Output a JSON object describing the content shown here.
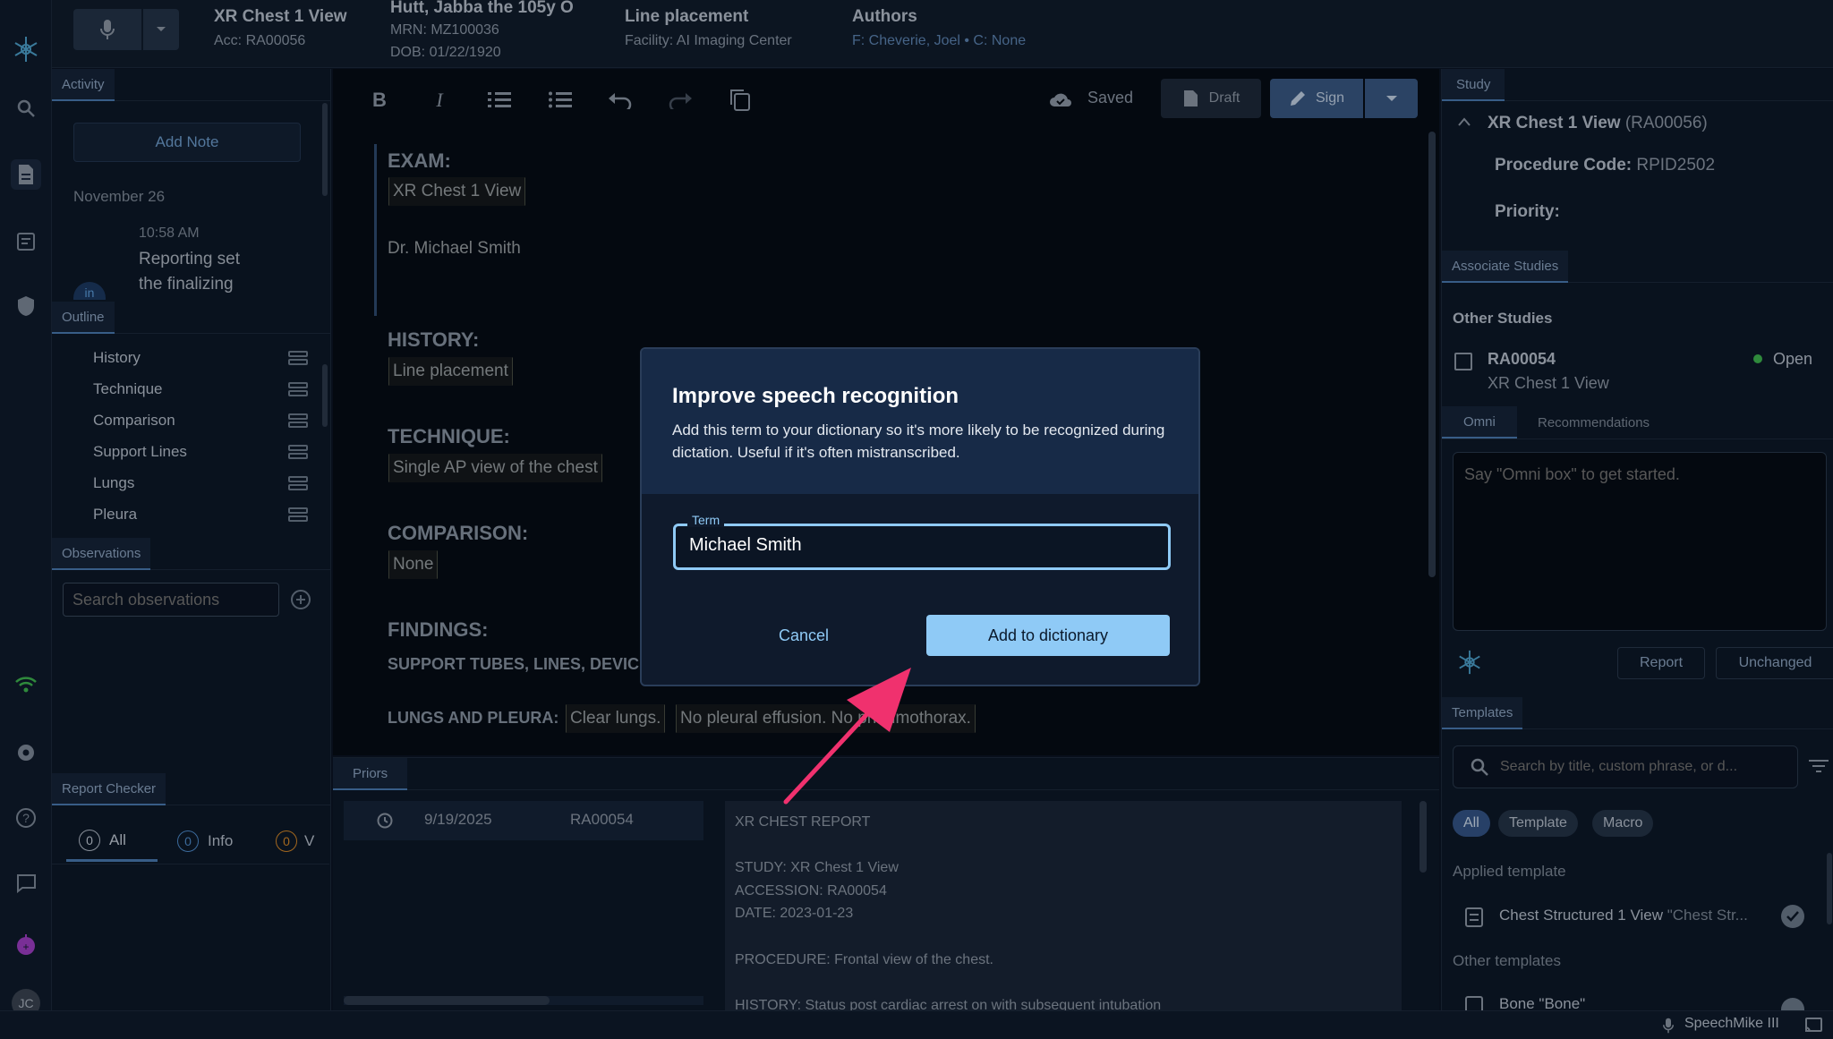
{
  "header": {
    "study_title": "XR Chest 1 View",
    "accession": "Acc: RA00056",
    "patient_name": "Hutt, Jabba the 105y O",
    "mrn": "MRN: MZ100036",
    "dob": "DOB: 01/22/1920",
    "reason_title": "Line placement",
    "facility": "Facility: AI Imaging Center",
    "authors_title": "Authors",
    "authors": "F: Cheverie, Joel • C: None"
  },
  "activity": {
    "tab": "Activity",
    "add_note": "Add Note",
    "date": "November 26",
    "time": "10:58 AM",
    "message_line1": "Reporting set",
    "message_line2": "the finalizing"
  },
  "outline": {
    "tab": "Outline",
    "items": [
      "History",
      "Technique",
      "Comparison",
      "Support Lines",
      "Lungs",
      "Pleura"
    ]
  },
  "observations": {
    "tab": "Observations",
    "search_placeholder": "Search observations"
  },
  "report_checker": {
    "tab": "Report Checker",
    "all_count": "0",
    "all_label": "All",
    "info_count": "0",
    "info_label": "Info",
    "warn_count": "0",
    "warn_label": "V"
  },
  "editor": {
    "saved": "Saved",
    "draft": "Draft",
    "sign": "Sign",
    "exam_title": "EXAM:",
    "exam_value": "XR Chest 1 View",
    "doctor": "Dr. Michael Smith",
    "history_title": "HISTORY:",
    "history_value": "Line placement",
    "technique_title": "TECHNIQUE:",
    "technique_value": "Single AP view of the chest",
    "comparison_title": "COMPARISON:",
    "comparison_value": "None",
    "findings_title": "FINDINGS:",
    "support_line": "SUPPORT TUBES, LINES, DEVIC",
    "lungs_label": "LUNGS AND PLEURA:",
    "lungs_value1": "Clear lungs.",
    "lungs_value2": "No pleural effusion. No pneumothorax."
  },
  "priors": {
    "tab": "Priors",
    "row_date": "9/19/2025",
    "row_acc": "RA00054",
    "report_lines": [
      "XR CHEST REPORT",
      "",
      "STUDY: XR Chest 1 View",
      "ACCESSION: RA00054",
      "DATE: 2023-01-23",
      "",
      "PROCEDURE: Frontal view of the chest.",
      "",
      "HISTORY: Status post cardiac arrest on with subsequent intubation"
    ]
  },
  "study": {
    "tab": "Study",
    "title": "XR Chest 1 View",
    "title_acc": "(RA00056)",
    "procedure_label": "Procedure Code:",
    "procedure_value": "RPID2502",
    "priority_label": "Priority:",
    "assoc_tab": "Associate Studies",
    "other_studies": "Other Studies",
    "other_acc": "RA00054",
    "other_title": "XR Chest 1 View",
    "other_status": "Open"
  },
  "omni": {
    "tab_omni": "Omni",
    "tab_recs": "Recommendations",
    "placeholder": "Say \"Omni box\" to get started.",
    "report_btn": "Report",
    "unchanged_btn": "Unchanged"
  },
  "templates": {
    "tab": "Templates",
    "search_placeholder": "Search by title, custom phrase, or d...",
    "chips": [
      "All",
      "Template",
      "Macro"
    ],
    "applied_label": "Applied template",
    "applied_name": "Chest Structured 1 View",
    "applied_alias": "\"Chest Str...",
    "other_label": "Other templates",
    "other_first": "Bone \"Bone\""
  },
  "status": {
    "device": "SpeechMike III",
    "avatar": "JC"
  },
  "modal": {
    "title": "Improve speech recognition",
    "description": "Add this term to your dictionary so it's more likely to be recognized during dictation. Useful if it's often mistranscribed.",
    "term_label": "Term",
    "term_value": "Michael Smith",
    "cancel": "Cancel",
    "add": "Add to dictionary"
  },
  "colors": {
    "accent": "#8fcaf6",
    "arrow": "#f0316e",
    "status_open": "#3fb950"
  }
}
